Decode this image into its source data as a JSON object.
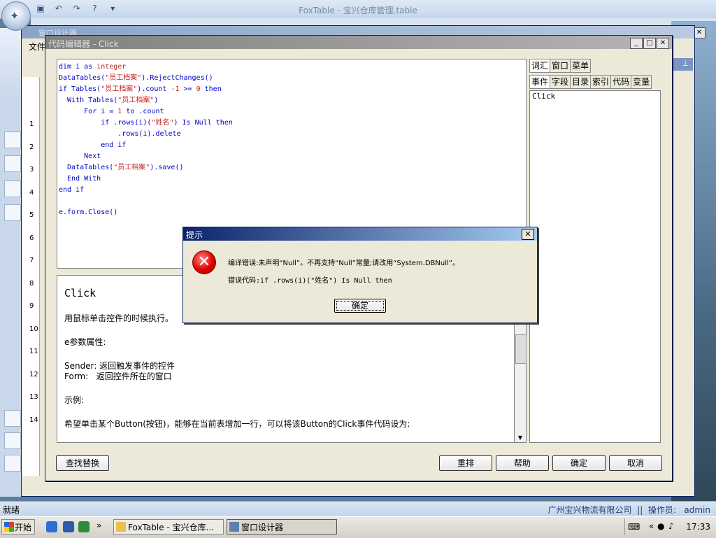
{
  "app": {
    "title": "FoxTable - 宝兴仓库管理.table",
    "status_left": "就绪",
    "status_company": "广州宝兴物流有限公司",
    "status_operator_label": "操作员:",
    "status_operator": "admin",
    "left_ruler": [
      "1",
      "2",
      "3",
      "4",
      "5",
      "6",
      "7",
      "8",
      "9",
      "10",
      "11",
      "12",
      "13",
      "14"
    ]
  },
  "designer": {
    "title": "窗口设计器",
    "menu_file": "文件"
  },
  "editor": {
    "title": "代码编辑器 - Click",
    "code_lines": [
      [
        {
          "t": "dim i as ",
          "c": "kw"
        },
        {
          "t": "integer",
          "c": "str"
        }
      ],
      [
        {
          "t": "DataTables(",
          "c": "kw"
        },
        {
          "t": "\"员工档案\"",
          "c": "str"
        },
        {
          "t": ").RejectChanges()",
          "c": "kw"
        }
      ],
      [
        {
          "t": "if Tables(",
          "c": "kw"
        },
        {
          "t": "\"员工档案\"",
          "c": "str"
        },
        {
          "t": ").count ",
          "c": "kw"
        },
        {
          "t": "-1",
          "c": "num"
        },
        {
          "t": " >= ",
          "c": "kw"
        },
        {
          "t": "0",
          "c": "num"
        },
        {
          "t": " then",
          "c": "kw"
        }
      ],
      [
        {
          "t": "  With Tables(",
          "c": "kw"
        },
        {
          "t": "\"员工档案\"",
          "c": "str"
        },
        {
          "t": ")",
          "c": "kw"
        }
      ],
      [
        {
          "t": "      For i = ",
          "c": "kw"
        },
        {
          "t": "1",
          "c": "num"
        },
        {
          "t": " to .count",
          "c": "kw"
        }
      ],
      [
        {
          "t": "          if .rows(i)(",
          "c": "kw"
        },
        {
          "t": "\"姓名\"",
          "c": "str"
        },
        {
          "t": ") Is Null then",
          "c": "kw"
        }
      ],
      [
        {
          "t": "              .rows(i).delete",
          "c": "kw"
        }
      ],
      [
        {
          "t": "          end if",
          "c": "kw"
        }
      ],
      [
        {
          "t": "      Next",
          "c": "kw"
        }
      ],
      [
        {
          "t": "  DataTables(",
          "c": "kw"
        },
        {
          "t": "\"员工档案\"",
          "c": "str"
        },
        {
          "t": ").save()",
          "c": "kw"
        }
      ],
      [
        {
          "t": "  End With",
          "c": "kw"
        }
      ],
      [
        {
          "t": "end if",
          "c": "kw"
        }
      ],
      [
        {
          "t": "",
          "c": "kw"
        }
      ],
      [
        {
          "t": "e.form.Close()",
          "c": "kw"
        }
      ]
    ],
    "doc_title": "Click",
    "doc_lines": [
      "用鼠标单击控件的时候执行。",
      "e参数属性:",
      "Sender: 返回触发事件的控件",
      "Form:   返回控件所在的窗口",
      "示例:",
      "希望单击某个Button(按钮)，能够在当前表增加一行，可以将该Button的Click事件代码设为:"
    ],
    "side_tabs_top": [
      "词汇",
      "窗口",
      "菜单"
    ],
    "side_tabs_bottom": [
      "事件",
      "字段",
      "目录",
      "索引",
      "代码",
      "变量"
    ],
    "side_list": [
      "Click"
    ],
    "buttons": {
      "find_replace": "查找替换",
      "rearrange": "重排",
      "help": "帮助",
      "ok": "确定",
      "cancel": "取消"
    }
  },
  "dialog": {
    "title": "提示",
    "message": "编译错误:未声明“Null”。不再支持“Null”常量;请改用“System.DBNull”。",
    "error_code": "错误代码:if .rows(i)(\"姓名\") Is Null then",
    "ok": "确定"
  },
  "taskbar": {
    "start": "开始",
    "task1": "FoxTable - 宝兴仓库...",
    "task2": "窗口设计器",
    "clock": "17:33"
  },
  "colors": {
    "code_keyword": "#0000cc",
    "code_string": "#cc2222",
    "dialog_title": "#0a246a",
    "error_icon": "#e00000"
  }
}
